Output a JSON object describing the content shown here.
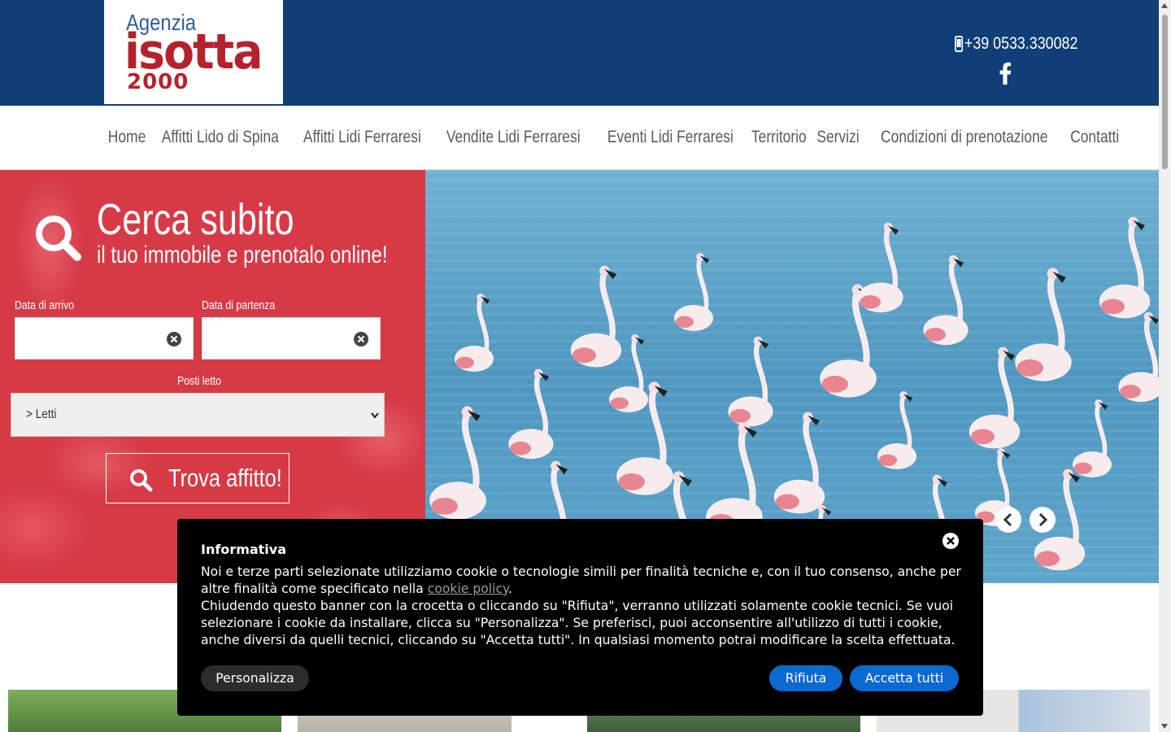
{
  "header": {
    "logo": {
      "line1": "Agenzia",
      "line2": "isotta",
      "line3": "2000"
    },
    "phone": "+39 0533.330082",
    "social_icon": "facebook-icon",
    "colors": {
      "bar": "#103f78",
      "brand_red": "#b5222c"
    }
  },
  "nav": {
    "items": [
      {
        "label": "Home"
      },
      {
        "label": "Affitti Lido di Spina"
      },
      {
        "label": "Affitti Lidi Ferraresi"
      },
      {
        "label": "Vendite Lidi Ferraresi"
      },
      {
        "label": "Eventi Lidi Ferraresi"
      },
      {
        "label": "Territorio"
      },
      {
        "label": "Servizi"
      },
      {
        "label": "Condizioni di prenotazione"
      },
      {
        "label": "Contatti"
      }
    ]
  },
  "search": {
    "title": "Cerca subito",
    "subtitle": "il tuo immobile e prenotalo online!",
    "arrival_label": "Data di arrivo",
    "arrival_value": "",
    "departure_label": "Data di partenza",
    "departure_value": "",
    "beds_label": "Posti letto",
    "beds_selected": "> Letti",
    "submit_label": "Trova affitto!",
    "panel_color": "#d63a47"
  },
  "slider": {
    "prev_icon": "chevron-left-icon",
    "next_icon": "chevron-right-icon"
  },
  "cookie": {
    "title": "Informativa",
    "text_before_link": "Noi e terze parti selezionate utilizziamo cookie o tecnologie simili per finalità tecniche e, con il tuo consenso, anche per altre finalità come specificato nella ",
    "link": "cookie policy",
    "text_after_link": ".",
    "text2": "Chiudendo questo banner con la crocetta o cliccando su \"Rifiuta\", verranno utilizzati solamente cookie tecnici. Se vuoi selezionare i cookie da installare, clicca su \"Personalizza\". Se preferisci, puoi acconsentire all'utilizzo di tutti i cookie, anche diversi da quelli tecnici, cliccando su \"Accetta tutti\". In qualsiasi momento potrai modificare la scelta effettuata.",
    "customize_label": "Personalizza",
    "reject_label": "Rifiuta",
    "accept_label": "Accetta tutti",
    "accent": "#0a6ad0"
  }
}
